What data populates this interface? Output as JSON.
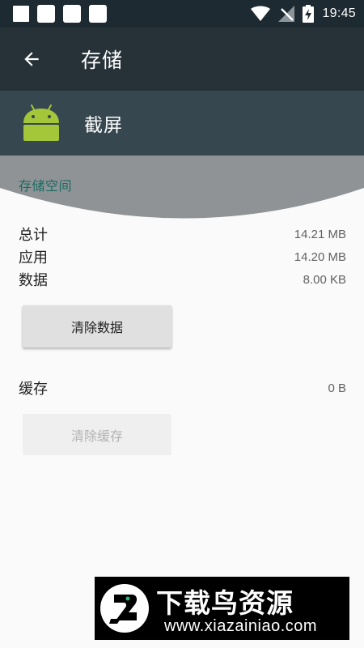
{
  "status_bar": {
    "time": "19:45",
    "icons": [
      "notification-square-icon",
      "notification-square-icon",
      "notification-square-icon",
      "notification-square-icon",
      "wifi-icon",
      "no-signal-icon",
      "battery-charging-icon"
    ]
  },
  "toolbar": {
    "back_icon": "arrow-back-icon",
    "title": "存储"
  },
  "app": {
    "icon": "android-robot-icon",
    "name": "截屏"
  },
  "storage": {
    "section_title": "存储空间",
    "rows": [
      {
        "label": "总计",
        "value": "14.21 MB"
      },
      {
        "label": "应用",
        "value": "14.20 MB"
      },
      {
        "label": "数据",
        "value": "8.00 KB"
      }
    ],
    "clear_data_label": "清除数据",
    "cache_label": "缓存",
    "cache_value": "0 B",
    "clear_cache_label": "清除缓存"
  },
  "colors": {
    "status_bar": "#1e2a31",
    "toolbar": "#263238",
    "app_header": "#37474f",
    "section_gray": "#8f9396",
    "section_title": "#1c6a63",
    "background": "#fafafa"
  },
  "watermark": {
    "title": "下载鸟资源",
    "url": "www.xiazainiao.com"
  }
}
